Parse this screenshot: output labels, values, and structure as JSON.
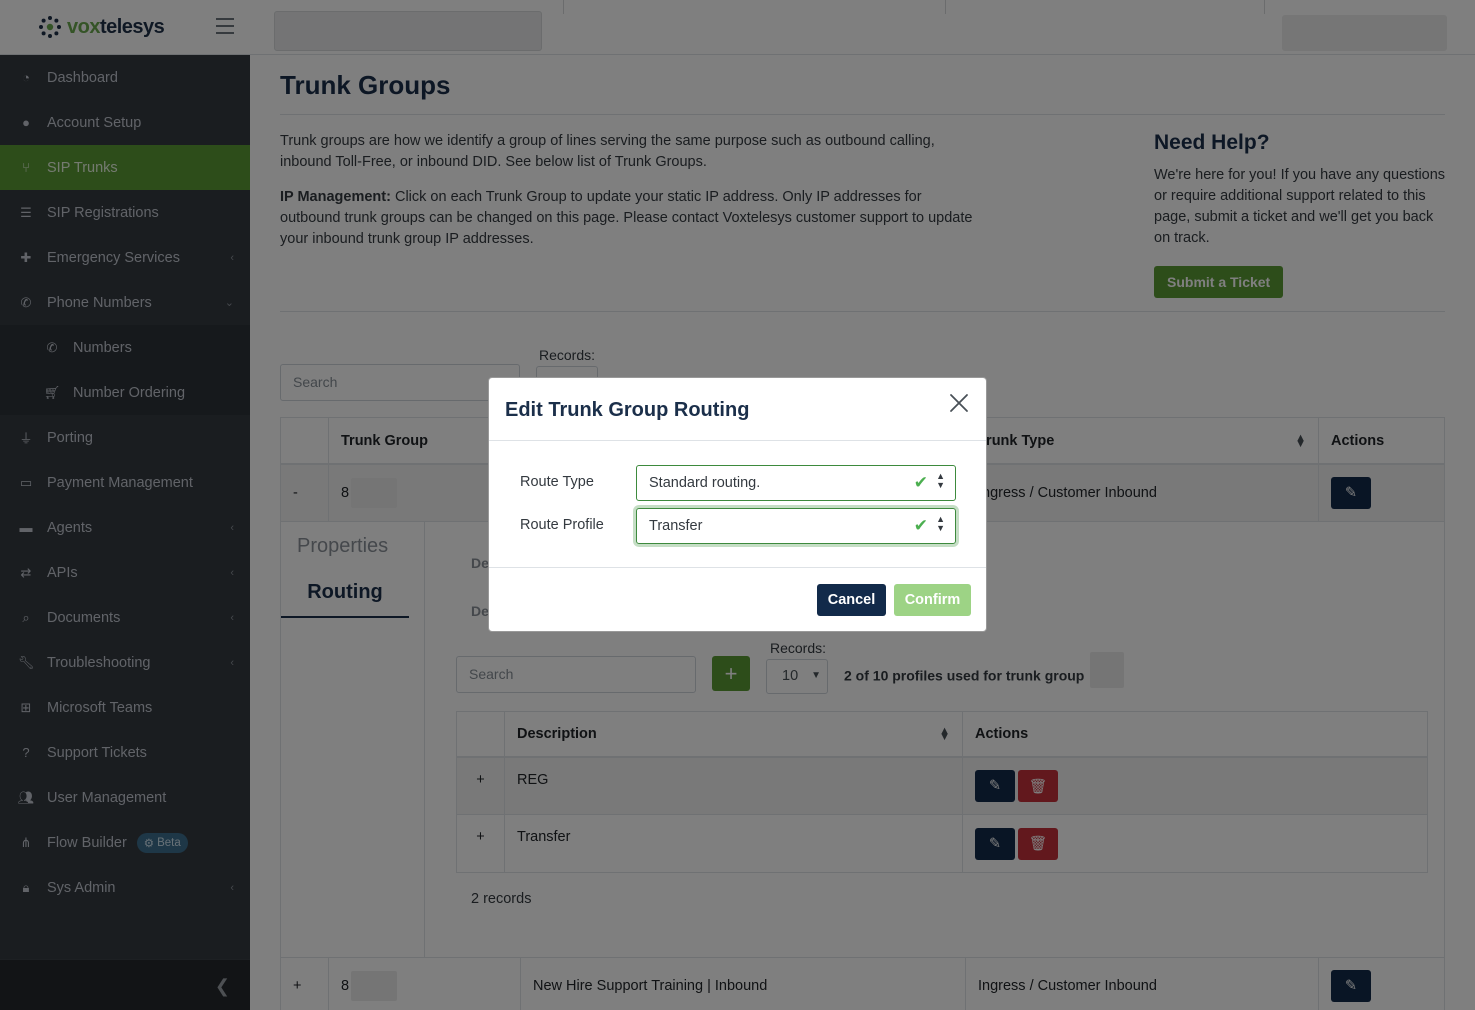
{
  "brand": {
    "logo_prefix": "vox",
    "logo_suffix": "telesys"
  },
  "sidebar": {
    "items": [
      {
        "label": "Dashboard",
        "icon": "dashboard-icon"
      },
      {
        "label": "Account Setup",
        "icon": "user-circle-icon"
      },
      {
        "label": "SIP Trunks",
        "icon": "branch-icon",
        "active": true
      },
      {
        "label": "SIP Registrations",
        "icon": "list-icon"
      },
      {
        "label": "Emergency Services",
        "icon": "medkit-icon",
        "expandable": true
      },
      {
        "label": "Phone Numbers",
        "icon": "phone-icon",
        "expanded": true
      },
      {
        "label": "Numbers",
        "icon": "phone-icon",
        "sub": true
      },
      {
        "label": "Number Ordering",
        "icon": "cart-icon",
        "sub": true
      },
      {
        "label": "Porting",
        "icon": "plug-icon"
      },
      {
        "label": "Payment Management",
        "icon": "credit-card-icon"
      },
      {
        "label": "Agents",
        "icon": "briefcase-icon",
        "expandable": true
      },
      {
        "label": "APIs",
        "icon": "exchange-icon",
        "expandable": true
      },
      {
        "label": "Documents",
        "icon": "search-icon",
        "expandable": true
      },
      {
        "label": "Troubleshooting",
        "icon": "wrench-icon",
        "expandable": true
      },
      {
        "label": "Microsoft Teams",
        "icon": "windows-icon"
      },
      {
        "label": "Support Tickets",
        "icon": "question-icon"
      },
      {
        "label": "User Management",
        "icon": "users-icon"
      },
      {
        "label": "Flow Builder",
        "icon": "flow-icon",
        "badge": "Beta"
      },
      {
        "label": "Sys Admin",
        "icon": "lock-icon",
        "expandable": true
      }
    ]
  },
  "page": {
    "title": "Trunk Groups",
    "intro_p1": "Trunk groups are how we identify a group of lines serving the same purpose such as outbound calling, inbound Toll-Free, or inbound DID. See below list of Trunk Groups.",
    "intro_p2_strong": "IP Management:",
    "intro_p2": " Click on each Trunk Group to update your static IP address. Only IP addresses for outbound trunk groups can be changed on this page. Please contact Voxtelesys customer support to update your inbound trunk group IP addresses."
  },
  "help": {
    "title": "Need Help?",
    "text": "We're here for you! If you have any questions or require additional support related to this page, submit a ticket and we'll get you back on track.",
    "button": "Submit a Ticket"
  },
  "main_table": {
    "search_placeholder": "Search",
    "records_label": "Records:",
    "headers": {
      "group": "Trunk Group",
      "type": "Trunk Type",
      "actions": "Actions"
    },
    "row1": {
      "toggle": "-",
      "group": "8",
      "type": "Ingress / Customer Inbound"
    },
    "row2": {
      "toggle": "+",
      "group": "8",
      "description": "New Hire Support Training | Inbound",
      "type": "Ingress / Customer Inbound"
    }
  },
  "detail": {
    "tab_properties": "Properties",
    "tab_routing": "Routing",
    "label_a": "De",
    "label_b": "De",
    "search_placeholder": "Search",
    "plus": "+",
    "records_label": "Records:",
    "records_value": "10",
    "profiles_used": "2 of 10 profiles used for trunk group",
    "inner_headers": {
      "description": "Description",
      "actions": "Actions"
    },
    "rows": [
      {
        "toggle": "+",
        "description": "REG"
      },
      {
        "toggle": "+",
        "description": "Transfer"
      }
    ],
    "record_count": "2 records"
  },
  "modal": {
    "title": "Edit Trunk Group Routing",
    "route_type_label": "Route Type",
    "route_type_value": "Standard routing.",
    "route_profile_label": "Route Profile",
    "route_profile_value": "Transfer",
    "cancel": "Cancel",
    "confirm": "Confirm"
  },
  "colors": {
    "sidebar_bg": "#343a40",
    "active_green": "#5a9a35",
    "navy": "#122a4a",
    "danger": "#c4313b",
    "confirm_disabled": "#9dd385"
  }
}
